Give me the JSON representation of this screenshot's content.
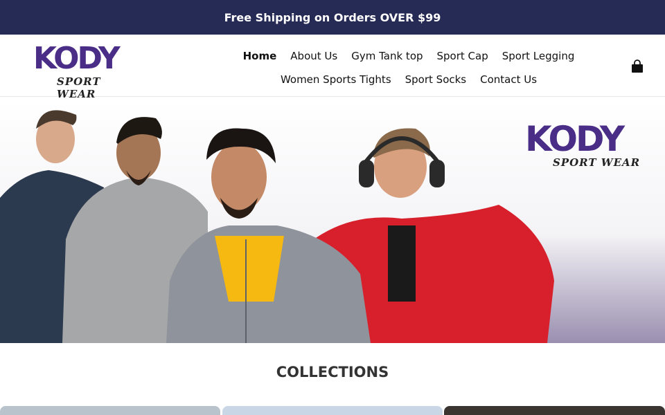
{
  "announcement": {
    "text": "Free Shipping on Orders OVER $99"
  },
  "brand": {
    "name": "KODY",
    "tagline": "SPORT WEAR"
  },
  "nav": {
    "row1": [
      {
        "label": "Home",
        "active": true
      },
      {
        "label": "About Us"
      },
      {
        "label": "Gym Tank top"
      },
      {
        "label": "Sport Cap"
      },
      {
        "label": "Sport Legging"
      }
    ],
    "row2": [
      {
        "label": "Women Sports Tights"
      },
      {
        "label": "Sport Socks"
      },
      {
        "label": "Contact Us"
      }
    ]
  },
  "cart": {
    "icon": "shopping-bag-icon"
  },
  "hero": {
    "logo_name": "KODY",
    "logo_tagline": "SPORT WEAR"
  },
  "collections": {
    "title": "COLLECTIONS"
  },
  "colors": {
    "announcement_bg": "#262b55",
    "brand_purple": "#4a2d86"
  }
}
